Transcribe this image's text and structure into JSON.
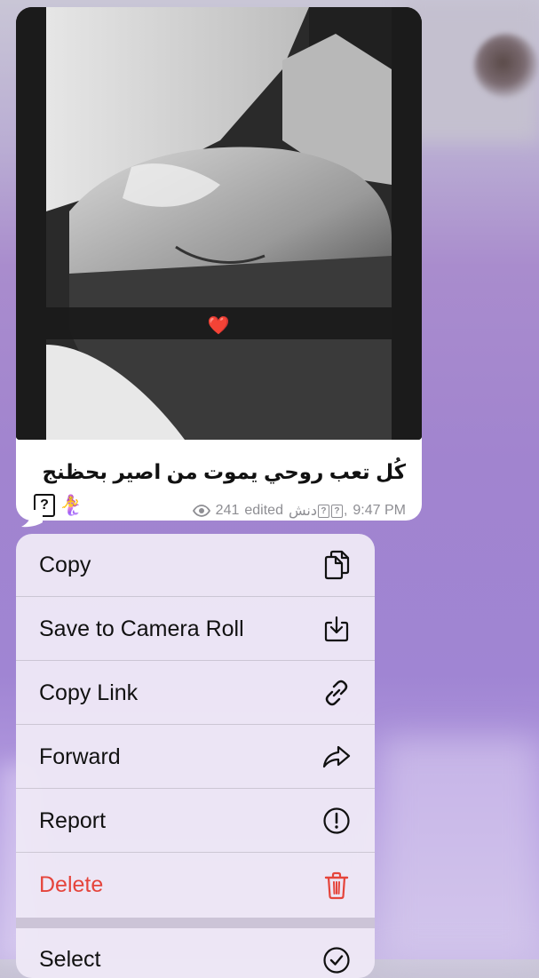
{
  "message": {
    "caption": "كُل تعب روحي يموت من اصير بحظنج",
    "caption_emojis": [
      "🧜‍♀️"
    ],
    "views": "241",
    "edited": "edited",
    "author": "دنش",
    "time": "9:47 PM",
    "photo_sticker": "❤️",
    "unknown_glyph": "?"
  },
  "context_menu": {
    "items": [
      {
        "label": "Copy",
        "icon": "copy-icon"
      },
      {
        "label": "Save to Camera Roll",
        "icon": "download-icon"
      },
      {
        "label": "Copy Link",
        "icon": "link-icon"
      },
      {
        "label": "Forward",
        "icon": "forward-icon"
      },
      {
        "label": "Report",
        "icon": "exclamation-circle-icon"
      },
      {
        "label": "Delete",
        "icon": "trash-icon",
        "destructive": true
      },
      {
        "label": "Select",
        "icon": "check-circle-icon"
      }
    ]
  },
  "colors": {
    "destructive": "#e5443b",
    "menu_background": "#eee8f6",
    "bubble_background": "#ffffff",
    "meta_text": "#8e8e93"
  }
}
